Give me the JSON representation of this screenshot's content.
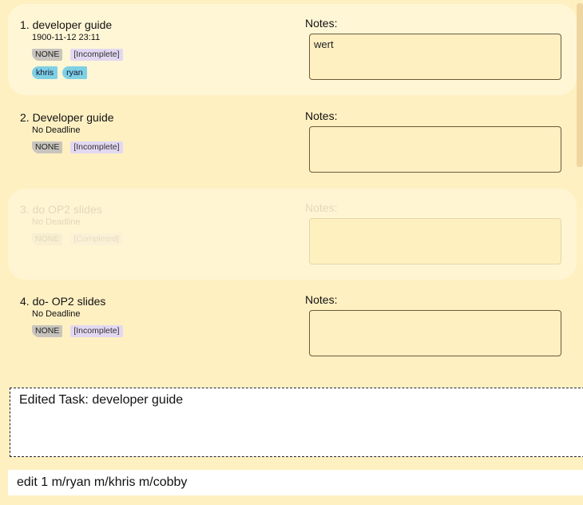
{
  "tasks": [
    {
      "title": "1. developer guide",
      "deadline": "1900-11-12 23:11",
      "priority": "NONE",
      "status": "[Incomplete]",
      "tags": [
        "khris",
        "ryan"
      ],
      "notes_label": "Notes:",
      "notes": "wert"
    },
    {
      "title": "2. Developer guide",
      "deadline": "No Deadline",
      "priority": "NONE",
      "status": "[Incomplete]",
      "tags": [],
      "notes_label": "Notes:",
      "notes": ""
    },
    {
      "title": "3. do OP2 slides",
      "deadline": "No Deadline",
      "priority": "NONE",
      "status": "[Completed]",
      "tags": [],
      "notes_label": "Notes:",
      "notes": ""
    },
    {
      "title": "4. do- OP2 slides",
      "deadline": "No Deadline",
      "priority": "NONE",
      "status": "[Incomplete]",
      "tags": [],
      "notes_label": "Notes:",
      "notes": ""
    }
  ],
  "result": {
    "text": "Edited Task: developer guide"
  },
  "command": {
    "value": "edit 1 m/ryan m/khris m/cobby"
  },
  "colors": {
    "background": "#fff0c2",
    "selected_card": "#fff6d6",
    "tag": "#7fd0e5",
    "priority_badge": "#c8c4bd",
    "status_badge": "#e2d8f2"
  }
}
